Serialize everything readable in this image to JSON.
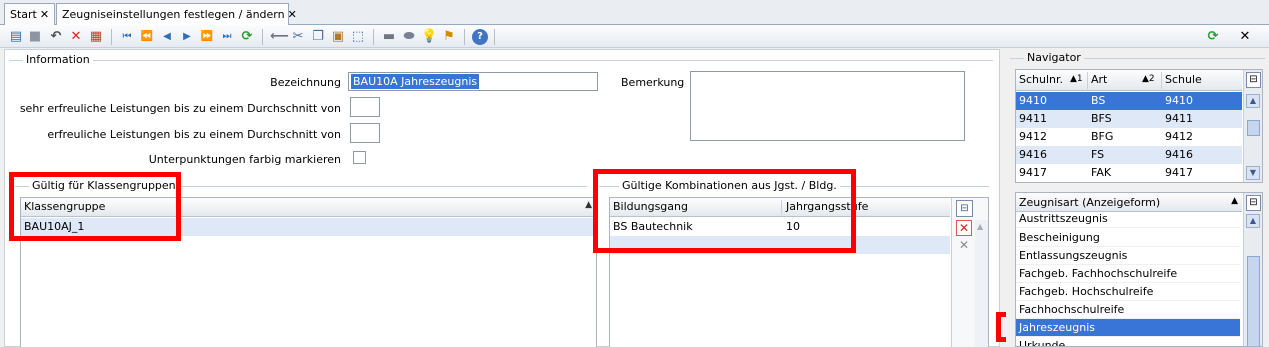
{
  "tabs": [
    {
      "label": "Start",
      "close": "✕"
    },
    {
      "label": "Zeugniseinstellungen festlegen / ändern",
      "close": "✕"
    }
  ],
  "toolbar": {
    "close_label": "✕"
  },
  "information": {
    "title": "Information",
    "bezeichnung_label": "Bezeichnung",
    "bezeichnung_value": "BAU10A Jahreszeugnis",
    "sehr_label": "sehr erfreuliche Leistungen bis zu einem Durchschnitt von",
    "erfr_label": "erfreuliche Leistungen bis zu einem Durchschnitt von",
    "unter_label": "Unterpunktungen farbig markieren",
    "bemerkung_label": "Bemerkung"
  },
  "klassengruppen": {
    "title": "Gültig für Klassengruppen",
    "header": "Klassengruppe",
    "rows": [
      "BAU10AJ_1"
    ]
  },
  "kombinationen": {
    "title": "Gültige Kombinationen aus Jgst. / Bldg.",
    "headers": [
      "Bildungsgang",
      "Jahrgangsstufe"
    ],
    "rows": [
      {
        "bildungsgang": "BS Bautechnik",
        "jahrgangsstufe": "10"
      }
    ]
  },
  "navigator": {
    "title": "Navigator",
    "headers": [
      "Schulnr.",
      "Art",
      "Schule"
    ],
    "sort_marks": [
      "▲1",
      "▲2"
    ],
    "rows": [
      [
        "9410",
        "BS",
        "9410"
      ],
      [
        "9411",
        "BFS",
        "9411"
      ],
      [
        "9412",
        "BFG",
        "9412"
      ],
      [
        "9416",
        "FS",
        "9416"
      ],
      [
        "9417",
        "FAK",
        "9417"
      ]
    ],
    "selected_index": 0
  },
  "zeugnisart": {
    "header": "Zeugnisart (Anzeigeform)",
    "items": [
      "Austrittszeugnis",
      "Bescheinigung",
      "Entlassungszeugnis",
      "Fachgeb. Fachhochschulreife",
      "Fachgeb. Hochschulreife",
      "Fachhochschulreife",
      "Jahreszeugnis",
      "Urkunde"
    ],
    "selected_index": 6
  },
  "colors": {
    "selection": "#3875d7",
    "highlight": "#ff0000",
    "row_alt": "#dfe8f6"
  },
  "icons": [
    "new-icon",
    "save-icon",
    "undo-icon",
    "delete-icon",
    "print-preview-icon",
    "first-icon",
    "prev-page-icon",
    "prev-icon",
    "next-icon",
    "next-page-icon",
    "last-icon",
    "refresh-icon",
    "back-icon",
    "cut-icon",
    "copy-icon",
    "paste-icon",
    "select-all-icon",
    "printer-icon",
    "disk-icon",
    "bulb-icon",
    "broom-icon",
    "help-icon"
  ]
}
